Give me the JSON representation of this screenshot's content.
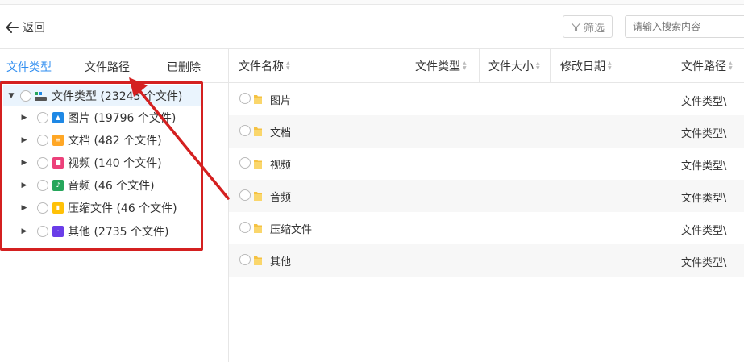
{
  "header": {
    "back_label": "返回",
    "filter_label": "筛选",
    "search_placeholder": "请输入搜索内容"
  },
  "tabs": [
    {
      "label": "文件类型",
      "active": true
    },
    {
      "label": "文件路径",
      "active": false
    },
    {
      "label": "已删除",
      "active": false
    }
  ],
  "tree": {
    "root_label": "文件类型 (23245 个文件)",
    "items": [
      {
        "label": "图片 (19796 个文件)",
        "icon": "image-icon",
        "color": "#1e88e5"
      },
      {
        "label": "文档 (482 个文件)",
        "icon": "document-icon",
        "color": "#ffa726"
      },
      {
        "label": "视频 (140 个文件)",
        "icon": "video-icon",
        "color": "#ec407a"
      },
      {
        "label": "音频 (46 个文件)",
        "icon": "audio-icon",
        "color": "#26a65b"
      },
      {
        "label": "压缩文件 (46 个文件)",
        "icon": "archive-icon",
        "color": "#ffc107"
      },
      {
        "label": "其他 (2735 个文件)",
        "icon": "other-icon",
        "color": "#6a3de8"
      }
    ]
  },
  "table": {
    "columns": [
      "文件名称",
      "文件类型",
      "文件大小",
      "修改日期",
      "文件路径"
    ],
    "rows": [
      {
        "name": "图片",
        "path": "文件类型\\"
      },
      {
        "name": "文档",
        "path": "文件类型\\"
      },
      {
        "name": "视频",
        "path": "文件类型\\"
      },
      {
        "name": "音频",
        "path": "文件类型\\"
      },
      {
        "name": "压缩文件",
        "path": "文件类型\\"
      },
      {
        "name": "其他",
        "path": "文件类型\\"
      }
    ]
  },
  "colors": {
    "accent": "#2d8cf0",
    "annotation": "#d42020",
    "folder": "#f5c242"
  }
}
